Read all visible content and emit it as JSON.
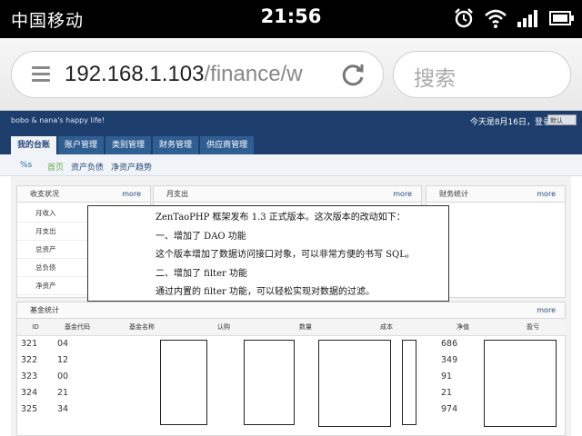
{
  "statusbar": {
    "carrier": "中国移动",
    "time": "21:56",
    "icons": [
      "alarm-icon",
      "wifi-icon",
      "signal-icon",
      "battery-icon"
    ]
  },
  "browser": {
    "url_host": "192.168.1.103",
    "url_path": "/finance/w",
    "search_placeholder": "搜索"
  },
  "site": {
    "slogan": "bobo & nana's happy life!",
    "today": "今天是8月16日，登录",
    "lang": "默认",
    "nav_tabs": [
      "我的台账",
      "账户管理",
      "类别管理",
      "财务管理",
      "供应商管理"
    ],
    "subnav": {
      "pct": "%s",
      "links": [
        "首页",
        "资产负债",
        "净资产趋势"
      ]
    }
  },
  "panels": {
    "income": {
      "title": "收支状况",
      "more": "more",
      "rows": [
        "月收入",
        "月支出",
        "总资产",
        "总负债",
        "净资产"
      ]
    },
    "expense": {
      "title": "月支出",
      "more": "more"
    },
    "stats": {
      "title": "财务统计",
      "more": "more"
    },
    "funds": {
      "title": "基金统计",
      "more": "more",
      "columns": [
        "ID",
        "基金代码",
        "基金名称",
        "认购",
        "数量",
        "成本",
        "净值",
        "盈亏"
      ],
      "rows": [
        {
          "id": "321",
          "code": "04",
          "nav": "686"
        },
        {
          "id": "322",
          "code": "12",
          "nav": "349"
        },
        {
          "id": "323",
          "code": "00",
          "nav": "91"
        },
        {
          "id": "324",
          "code": "21",
          "nav": "21"
        },
        {
          "id": "325",
          "code": "34",
          "nav": "974"
        }
      ]
    }
  },
  "popup": {
    "lines": [
      "ZenTaoPHP 框架发布 1.3 正式版本。这次版本的改动如下：",
      "一、增加了 DAO 功能",
      "这个版本增加了数据访问接口对象，可以非常方便的书写 SQL。",
      "二、增加了 filter 功能",
      "通过内置的 filter 功能，可以轻松实现对数据的过滤。"
    ]
  }
}
